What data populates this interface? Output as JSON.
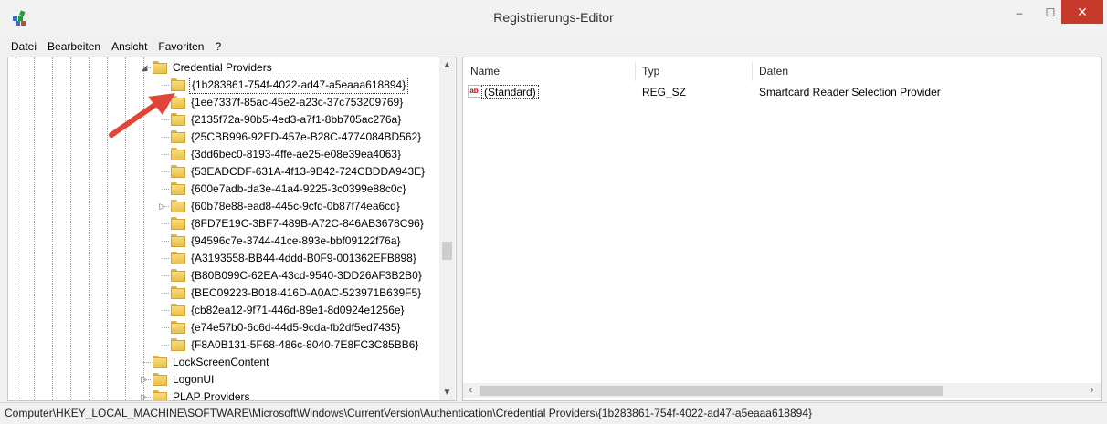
{
  "window": {
    "title": "Registrierungs-Editor",
    "controls": {
      "minimize": "–",
      "maximize": "☐",
      "close": "✕"
    }
  },
  "menu": [
    "Datei",
    "Bearbeiten",
    "Ansicht",
    "Favoriten",
    "?"
  ],
  "tree": {
    "parent_label": "Credential Providers",
    "children": [
      {
        "label": "{1b283861-754f-4022-ad47-a5eaaa618894}",
        "selected": true
      },
      {
        "label": "{1ee7337f-85ac-45e2-a23c-37c753209769}"
      },
      {
        "label": "{2135f72a-90b5-4ed3-a7f1-8bb705ac276a}"
      },
      {
        "label": "{25CBB996-92ED-457e-B28C-4774084BD562}"
      },
      {
        "label": "{3dd6bec0-8193-4ffe-ae25-e08e39ea4063}"
      },
      {
        "label": "{53EADCDF-631A-4f13-9B42-724CBDDA943E}"
      },
      {
        "label": "{600e7adb-da3e-41a4-9225-3c0399e88c0c}"
      },
      {
        "label": "{60b78e88-ead8-445c-9cfd-0b87f74ea6cd}",
        "expandable": true
      },
      {
        "label": "{8FD7E19C-3BF7-489B-A72C-846AB3678C96}"
      },
      {
        "label": "{94596c7e-3744-41ce-893e-bbf09122f76a}"
      },
      {
        "label": "{A3193558-BB44-4ddd-B0F9-001362EFB898}"
      },
      {
        "label": "{B80B099C-62EA-43cd-9540-3DD26AF3B2B0}"
      },
      {
        "label": "{BEC09223-B018-416D-A0AC-523971B639F5}"
      },
      {
        "label": "{cb82ea12-9f71-446d-89e1-8d0924e1256e}"
      },
      {
        "label": "{e74e57b0-6c6d-44d5-9cda-fb2df5ed7435}"
      },
      {
        "label": "{F8A0B131-5F68-486c-8040-7E8FC3C85BB6}"
      }
    ],
    "siblings": [
      {
        "label": "LockScreenContent",
        "expandable": false
      },
      {
        "label": "LogonUI",
        "expandable": true
      },
      {
        "label": "PLAP Providers",
        "expandable": true
      }
    ]
  },
  "list": {
    "columns": [
      "Name",
      "Typ",
      "Daten"
    ],
    "rows": [
      {
        "name": "(Standard)",
        "type": "REG_SZ",
        "data": "Smartcard Reader Selection Provider",
        "icon": "string-value-icon",
        "icon_text": "ab"
      }
    ]
  },
  "status": "Computer\\HKEY_LOCAL_MACHINE\\SOFTWARE\\Microsoft\\Windows\\CurrentVersion\\Authentication\\Credential Providers\\{1b283861-754f-4022-ad47-a5eaaa618894}",
  "colors": {
    "annotation_arrow": "#e0453a",
    "close_button": "#c7392b",
    "folder": "#f2cf5b"
  }
}
